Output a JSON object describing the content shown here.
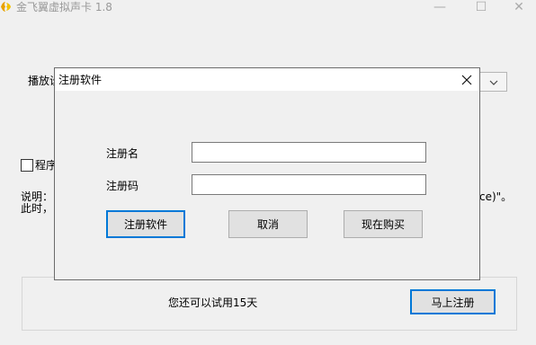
{
  "window": {
    "title": "金飞翼虚拟声卡 1.8",
    "min_glyph": "—",
    "max_glyph": "☐",
    "close_glyph": "✕"
  },
  "main": {
    "play_label": "播放设",
    "startup_label": "程序",
    "desc_line1": "说明：",
    "desc_line2": "此时，",
    "desc_right": "ce)\"。",
    "trial_text": "您还可以试用15天",
    "register_now": "马上注册"
  },
  "dialog": {
    "title": "注册软件",
    "name_label": "注册名",
    "code_label": "注册码",
    "name_value": "",
    "code_value": "",
    "register_button": "注册软件",
    "cancel_button": "取消",
    "buy_button": "现在购买"
  },
  "colors": {
    "focus_border": "#0078d7",
    "window_bg": "#f0f0f0",
    "logo_orange": "#e8a200"
  }
}
